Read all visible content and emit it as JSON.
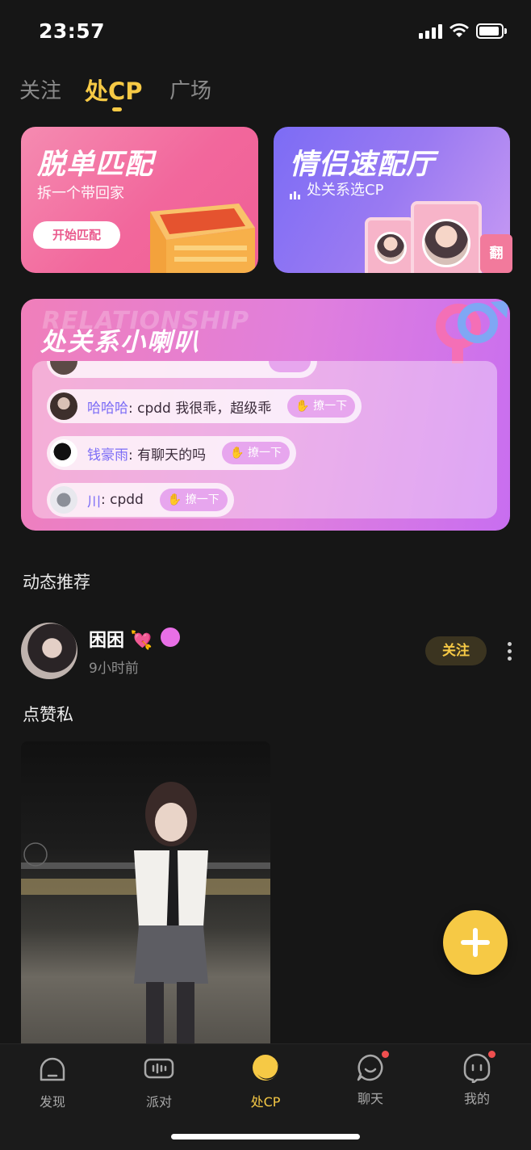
{
  "status": {
    "time": "23:57"
  },
  "tabs": [
    {
      "label": "关注"
    },
    {
      "label": "处CP"
    },
    {
      "label": "广场"
    }
  ],
  "cards": {
    "single": {
      "title": "脱单匹配",
      "subtitle": "拆一个带回家",
      "button": "开始匹配"
    },
    "speed": {
      "title": "情侣速配厅",
      "subtitle": "处关系选CP",
      "flip": "翻"
    }
  },
  "relationship": {
    "watermark": "RELATIONSHIP",
    "title": "处关系小喇叭",
    "messages": [
      {
        "name": "哈哈哈",
        "text": ": cpdd 我很乖，超级乖",
        "action": "撩一下"
      },
      {
        "name": "钱豪雨",
        "text": ": 有聊天的吗",
        "action": "撩一下"
      },
      {
        "name": "川",
        "text": ": cpdd",
        "action": "撩一下"
      }
    ]
  },
  "feed": {
    "section_title": "动态推荐",
    "post": {
      "name": "困困",
      "time": "9小时前",
      "follow": "关注",
      "text": "点赞私"
    }
  },
  "nav": [
    {
      "label": "发现",
      "icon": "discover-icon"
    },
    {
      "label": "派对",
      "icon": "party-icon"
    },
    {
      "label": "处CP",
      "icon": "cp-icon"
    },
    {
      "label": "聊天",
      "icon": "chat-icon"
    },
    {
      "label": "我的",
      "icon": "profile-icon"
    }
  ],
  "colors": {
    "accent": "#f6c945",
    "background": "#161616",
    "pink": "#f2679c",
    "purple": "#9a7af2"
  }
}
